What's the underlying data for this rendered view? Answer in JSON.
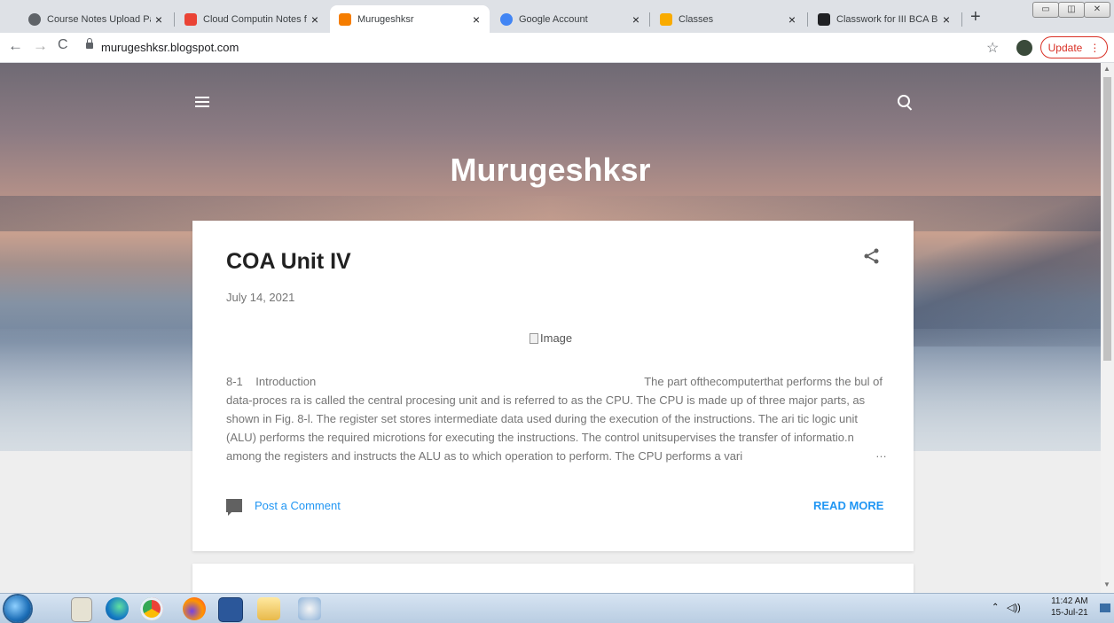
{
  "tabs": [
    {
      "label": "Course Notes Upload Page",
      "icon": "globe-icon",
      "color": "#5f6368"
    },
    {
      "label": "Cloud Computin Notes for F",
      "icon": "gmail-icon",
      "color": "#ea4335"
    },
    {
      "label": "Murugeshksr",
      "icon": "blogger-icon",
      "color": "#f57d00"
    },
    {
      "label": "Google Account",
      "icon": "google-icon",
      "color": "#4285f4"
    },
    {
      "label": "Classes",
      "icon": "classroom-icon",
      "color": "#f9ab00"
    },
    {
      "label": "Classwork for III BCA B",
      "icon": "classroom-dark-icon",
      "color": "#202124"
    }
  ],
  "toolbar": {
    "url": "murugeshksr.blogspot.com",
    "update_label": "Update"
  },
  "blog": {
    "title": "Murugeshksr"
  },
  "post": {
    "title": "COA Unit IV",
    "date": "July 14, 2021",
    "image_alt": "Image",
    "snippet_head_left": "8-1    Introduction",
    "snippet_head_right": "The part ofthecomputerthat performs the bul of",
    "snippet_body": "data-proces ra is called the central procesing unit and is referred to as the CPU. The CPU is made up of three major parts, as shown in Fig. 8-l. The register set stores intermediate data used during the execution of the instructions. The ari tic logic unit (ALU) performs the required microtions for executing the instructions. The control unitsupervises the transfer of informatio.n among the registers and instructs the ALU as to which operation to perform. The CPU performs a vari",
    "ellipsis": "…",
    "comment_label": "Post a Comment",
    "read_more": "READ MORE"
  },
  "taskbar": {
    "time": "11:42 AM",
    "date": "15-Jul-21"
  }
}
